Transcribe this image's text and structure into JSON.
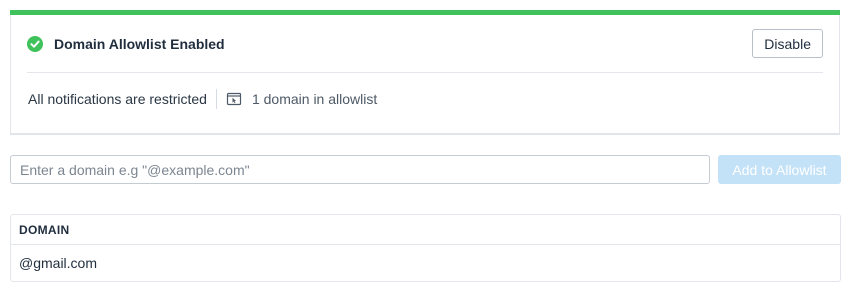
{
  "status": {
    "title": "Domain Allowlist Enabled",
    "icon": "check-circle-icon",
    "accent_color": "#3fc15b",
    "disable_label": "Disable",
    "restriction_text": "All notifications are restricted",
    "domain_count_icon": "window-icon",
    "domain_count_text": "1 domain in allowlist"
  },
  "add_form": {
    "placeholder": "Enter a domain e.g \"@example.com\"",
    "value": "",
    "add_label": "Add to Allowlist",
    "add_button_color": "#c4e2f7"
  },
  "table": {
    "columns": [
      "DOMAIN"
    ],
    "rows": [
      {
        "domain": "@gmail.com"
      }
    ]
  }
}
